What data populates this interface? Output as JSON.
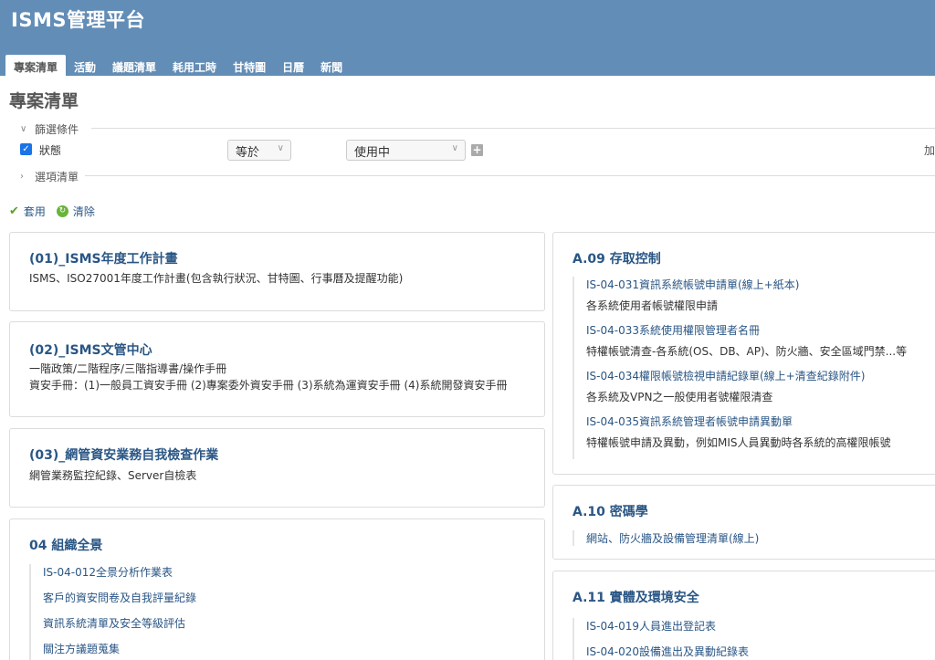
{
  "app": {
    "title": "ISMS管理平台"
  },
  "tabs": [
    {
      "label": "專案清單",
      "active": true
    },
    {
      "label": "活動"
    },
    {
      "label": "議題清單"
    },
    {
      "label": "耗用工時"
    },
    {
      "label": "甘特圖"
    },
    {
      "label": "日曆"
    },
    {
      "label": "新聞"
    }
  ],
  "page": {
    "title": "專案清單"
  },
  "filters": {
    "legend": "篩選條件",
    "status_label": "狀態",
    "operator_value": "等於",
    "status_value": "使用中",
    "add_filter_label": "加",
    "options_legend": "選項清單"
  },
  "actions": {
    "apply_label": "套用",
    "clear_label": "清除"
  },
  "cards": {
    "c1": {
      "title": "(01)_ISMS年度工作計畫",
      "desc": "ISMS、ISO27001年度工作計畫(包含執行狀況、甘特圖、行事曆及提醒功能)"
    },
    "c2": {
      "title": "(02)_ISMS文管中心",
      "desc1": "一階政策/二階程序/三階指導書/操作手冊",
      "desc2": "資安手冊：(1)一般員工資安手冊 (2)專案委外資安手冊 (3)系統為運資安手冊 (4)系統開發資安手冊"
    },
    "c3": {
      "title": "(03)_網管資安業務自我檢查作業",
      "desc": "網管業務監控紀錄、Server自檢表"
    },
    "c4": {
      "title": "04 組織全景",
      "items": [
        "IS-04-012全景分析作業表",
        "客戶的資安問卷及自我評量紀錄",
        "資訊系統清單及安全等級評估",
        "關注方議題蒐集"
      ]
    },
    "a09": {
      "title": "A.09 存取控制",
      "items": [
        {
          "link": "IS-04-031資訊系統帳號申請單(線上+紙本)",
          "desc": "各系統使用者帳號權限申請"
        },
        {
          "link": "IS-04-033系統使用權限管理者名冊",
          "desc": "特權帳號清查-各系統(OS、DB、AP)、防火牆、安全區域門禁...等"
        },
        {
          "link": "IS-04-034權限帳號檢視申請紀錄單(線上+清查紀錄附件)",
          "desc": "各系統及VPN之一般使用者號權限清查"
        },
        {
          "link": "IS-04-035資訊系統管理者帳號申請異動單",
          "desc": "特權帳號申請及異動，例如MIS人員異動時各系統的高權限帳號"
        }
      ]
    },
    "a10": {
      "title": "A.10 密碼學",
      "items": [
        {
          "link": "網站、防火牆及設備管理清單(線上)"
        }
      ]
    },
    "a11": {
      "title": "A.11 實體及環境安全",
      "items": [
        {
          "link": "IS-04-019人員進出登記表"
        },
        {
          "link": "IS-04-020設備進出及異動紀錄表"
        }
      ]
    }
  }
}
